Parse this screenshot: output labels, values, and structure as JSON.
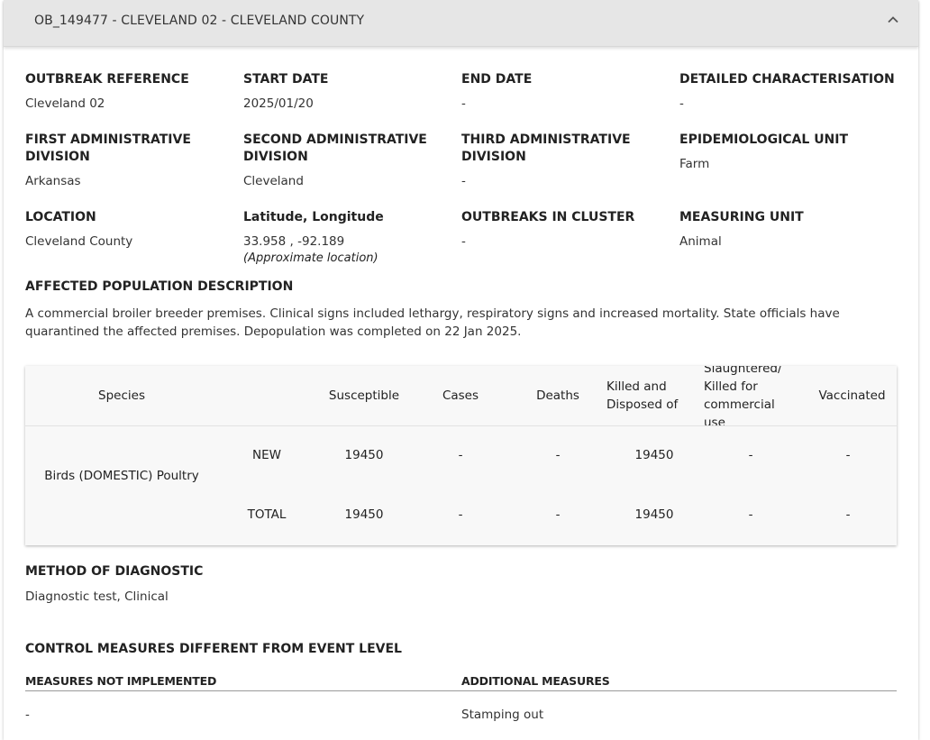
{
  "header": {
    "title": "OB_149477 - CLEVELAND 02 - CLEVELAND COUNTY"
  },
  "fields": {
    "outbreak_reference": {
      "label": "OUTBREAK REFERENCE",
      "value": "Cleveland 02"
    },
    "start_date": {
      "label": "START DATE",
      "value": "2025/01/20"
    },
    "end_date": {
      "label": "END DATE",
      "value": "-"
    },
    "detailed_characterisation": {
      "label": "DETAILED CHARACTERISATION",
      "value": "-"
    },
    "first_admin": {
      "label": "FIRST ADMINISTRATIVE DIVISION",
      "value": "Arkansas"
    },
    "second_admin": {
      "label": "SECOND ADMINISTRATIVE DIVISION",
      "value": "Cleveland"
    },
    "third_admin": {
      "label": "THIRD ADMINISTRATIVE DIVISION",
      "value": "-"
    },
    "epi_unit": {
      "label": "EPIDEMIOLOGICAL UNIT",
      "value": "Farm"
    },
    "location": {
      "label": "LOCATION",
      "value": "Cleveland County"
    },
    "lat_long": {
      "label": "Latitude, Longitude",
      "value": "33.958 , -92.189",
      "note": "(Approximate location)"
    },
    "outbreaks_in_cluster": {
      "label": "OUTBREAKS IN CLUSTER",
      "value": "-"
    },
    "measuring_unit": {
      "label": "MEASURING UNIT",
      "value": "Animal"
    }
  },
  "affected_population": {
    "label": "AFFECTED POPULATION DESCRIPTION",
    "text": "A commercial broiler breeder premises. Clinical signs included lethargy, respiratory signs and increased mortality. State officials have quarantined the affected premises. Depopulation was completed on 22 Jan 2025."
  },
  "species_table": {
    "headers": {
      "species": "Species",
      "susceptible": "Susceptible",
      "cases": "Cases",
      "deaths": "Deaths",
      "killed": "Killed and Disposed of",
      "slaughtered": "Slaughtered/ Killed for commercial use",
      "vaccinated": "Vaccinated"
    },
    "species_name": "Birds (DOMESTIC) Poultry",
    "rows": [
      {
        "type": "NEW",
        "susceptible": "19450",
        "cases": "-",
        "deaths": "-",
        "killed": "19450",
        "slaughtered": "-",
        "vaccinated": "-"
      },
      {
        "type": "TOTAL",
        "susceptible": "19450",
        "cases": "-",
        "deaths": "-",
        "killed": "19450",
        "slaughtered": "-",
        "vaccinated": "-"
      }
    ]
  },
  "diagnostic": {
    "label": "METHOD OF DIAGNOSTIC",
    "value": "Diagnostic test, Clinical"
  },
  "control_measures": {
    "label": "CONTROL MEASURES DIFFERENT FROM EVENT LEVEL",
    "not_implemented_label": "MEASURES NOT IMPLEMENTED",
    "not_implemented_value": "-",
    "additional_label": "ADDITIONAL MEASURES",
    "additional_value": "Stamping out"
  }
}
